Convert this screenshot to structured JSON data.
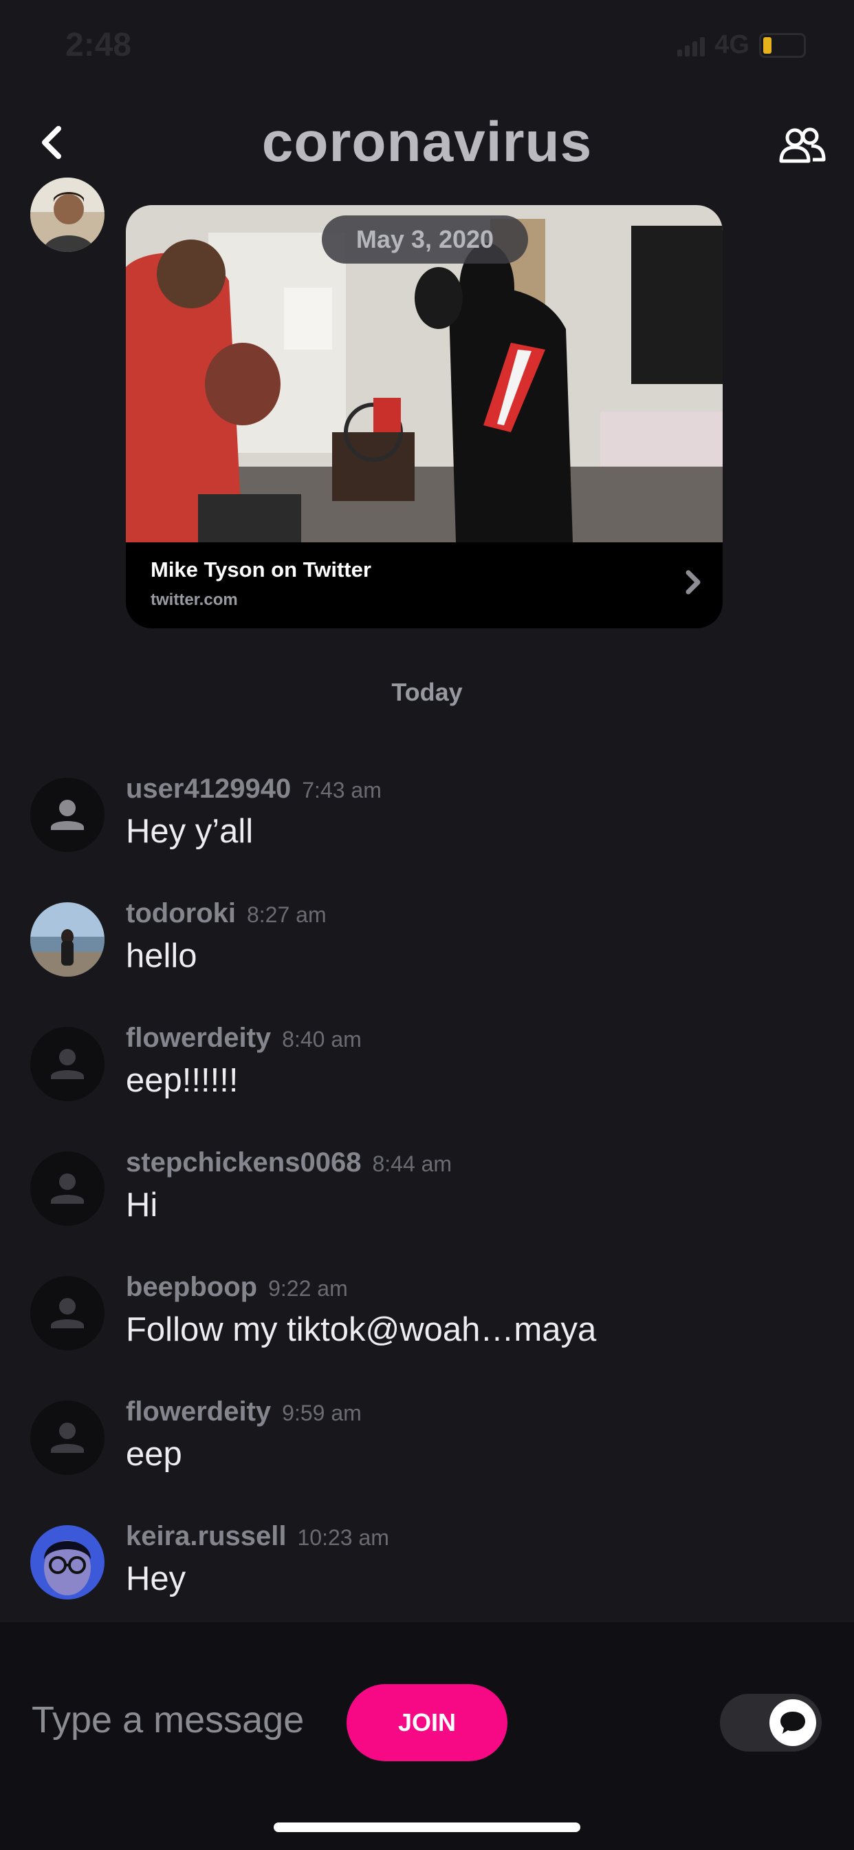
{
  "status_bar": {
    "time": "2:48",
    "network": "4G"
  },
  "header": {
    "title": "coronavirus",
    "back_icon": "chevron-left-icon",
    "members_icon": "group-icon"
  },
  "link_preview": {
    "date": "May 3, 2020",
    "title": "Mike Tyson on Twitter",
    "domain": "twitter.com"
  },
  "day_separator": "Today",
  "messages": [
    {
      "user": "user4129940",
      "time": "7:43 am",
      "text": "Hey y’all"
    },
    {
      "user": "todoroki",
      "time": "8:27 am",
      "text": "hello"
    },
    {
      "user": "flowerdeity",
      "time": "8:40 am",
      "text": "eep!!!!!!"
    },
    {
      "user": "stepchickens0068",
      "time": "8:44 am",
      "text": "Hi"
    },
    {
      "user": "beepboop",
      "time": "9:22 am",
      "text": "Follow my tiktok@woah…maya"
    },
    {
      "user": "flowerdeity",
      "time": "9:59 am",
      "text": "eep"
    },
    {
      "user": "keira.russell",
      "time": "10:23 am",
      "text": "Hey"
    }
  ],
  "composer": {
    "placeholder": "Type a message",
    "join_label": "JOIN"
  },
  "colors": {
    "background": "#17171c",
    "join": "#f70884",
    "battery": "#e7b31a"
  }
}
